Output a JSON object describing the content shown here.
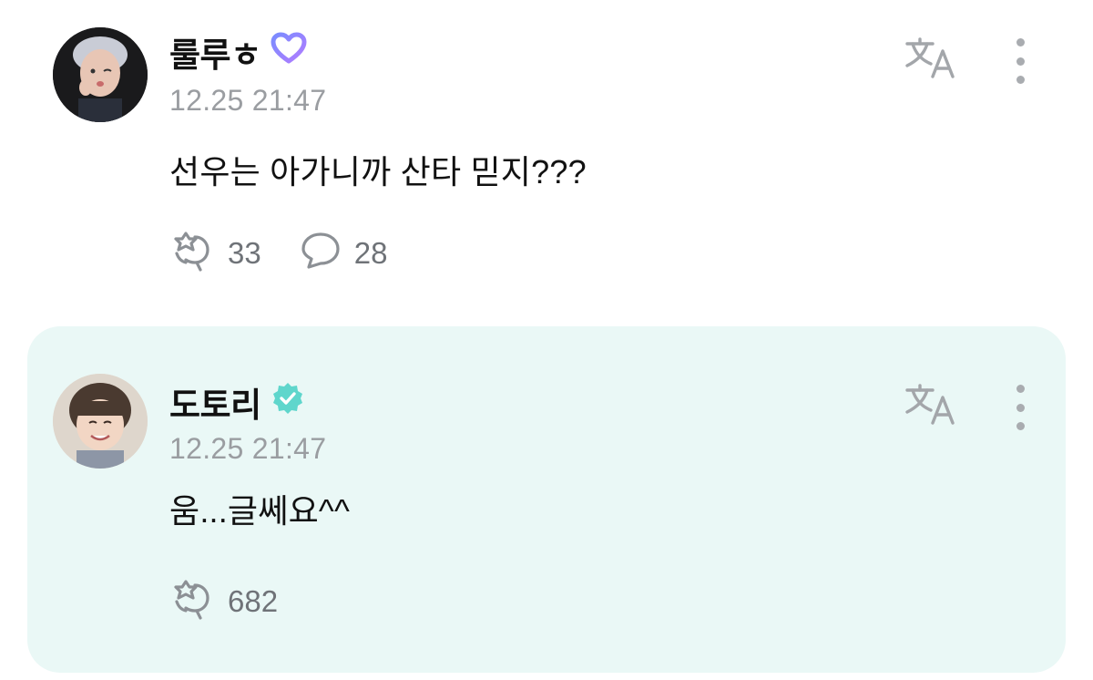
{
  "posts": [
    {
      "author": "룰루ㅎ",
      "badge_icon": "heart-membership-icon",
      "timestamp": "12.25 21:47",
      "text": "선우는 아가니까 산타 믿지???",
      "reactions": "33",
      "comments": "28"
    },
    {
      "author": "도토리",
      "badge_icon": "verified-badge-icon",
      "badge_color": "#5fd6cc",
      "timestamp": "12.25 21:47",
      "text": "움...글쎄요^^",
      "reactions": "682"
    }
  ],
  "colors": {
    "artist_card_bg": "#eaf8f6",
    "meta_gray": "#9a9da1",
    "heart_gradient": [
      "#7b8cff",
      "#b07cff"
    ]
  }
}
